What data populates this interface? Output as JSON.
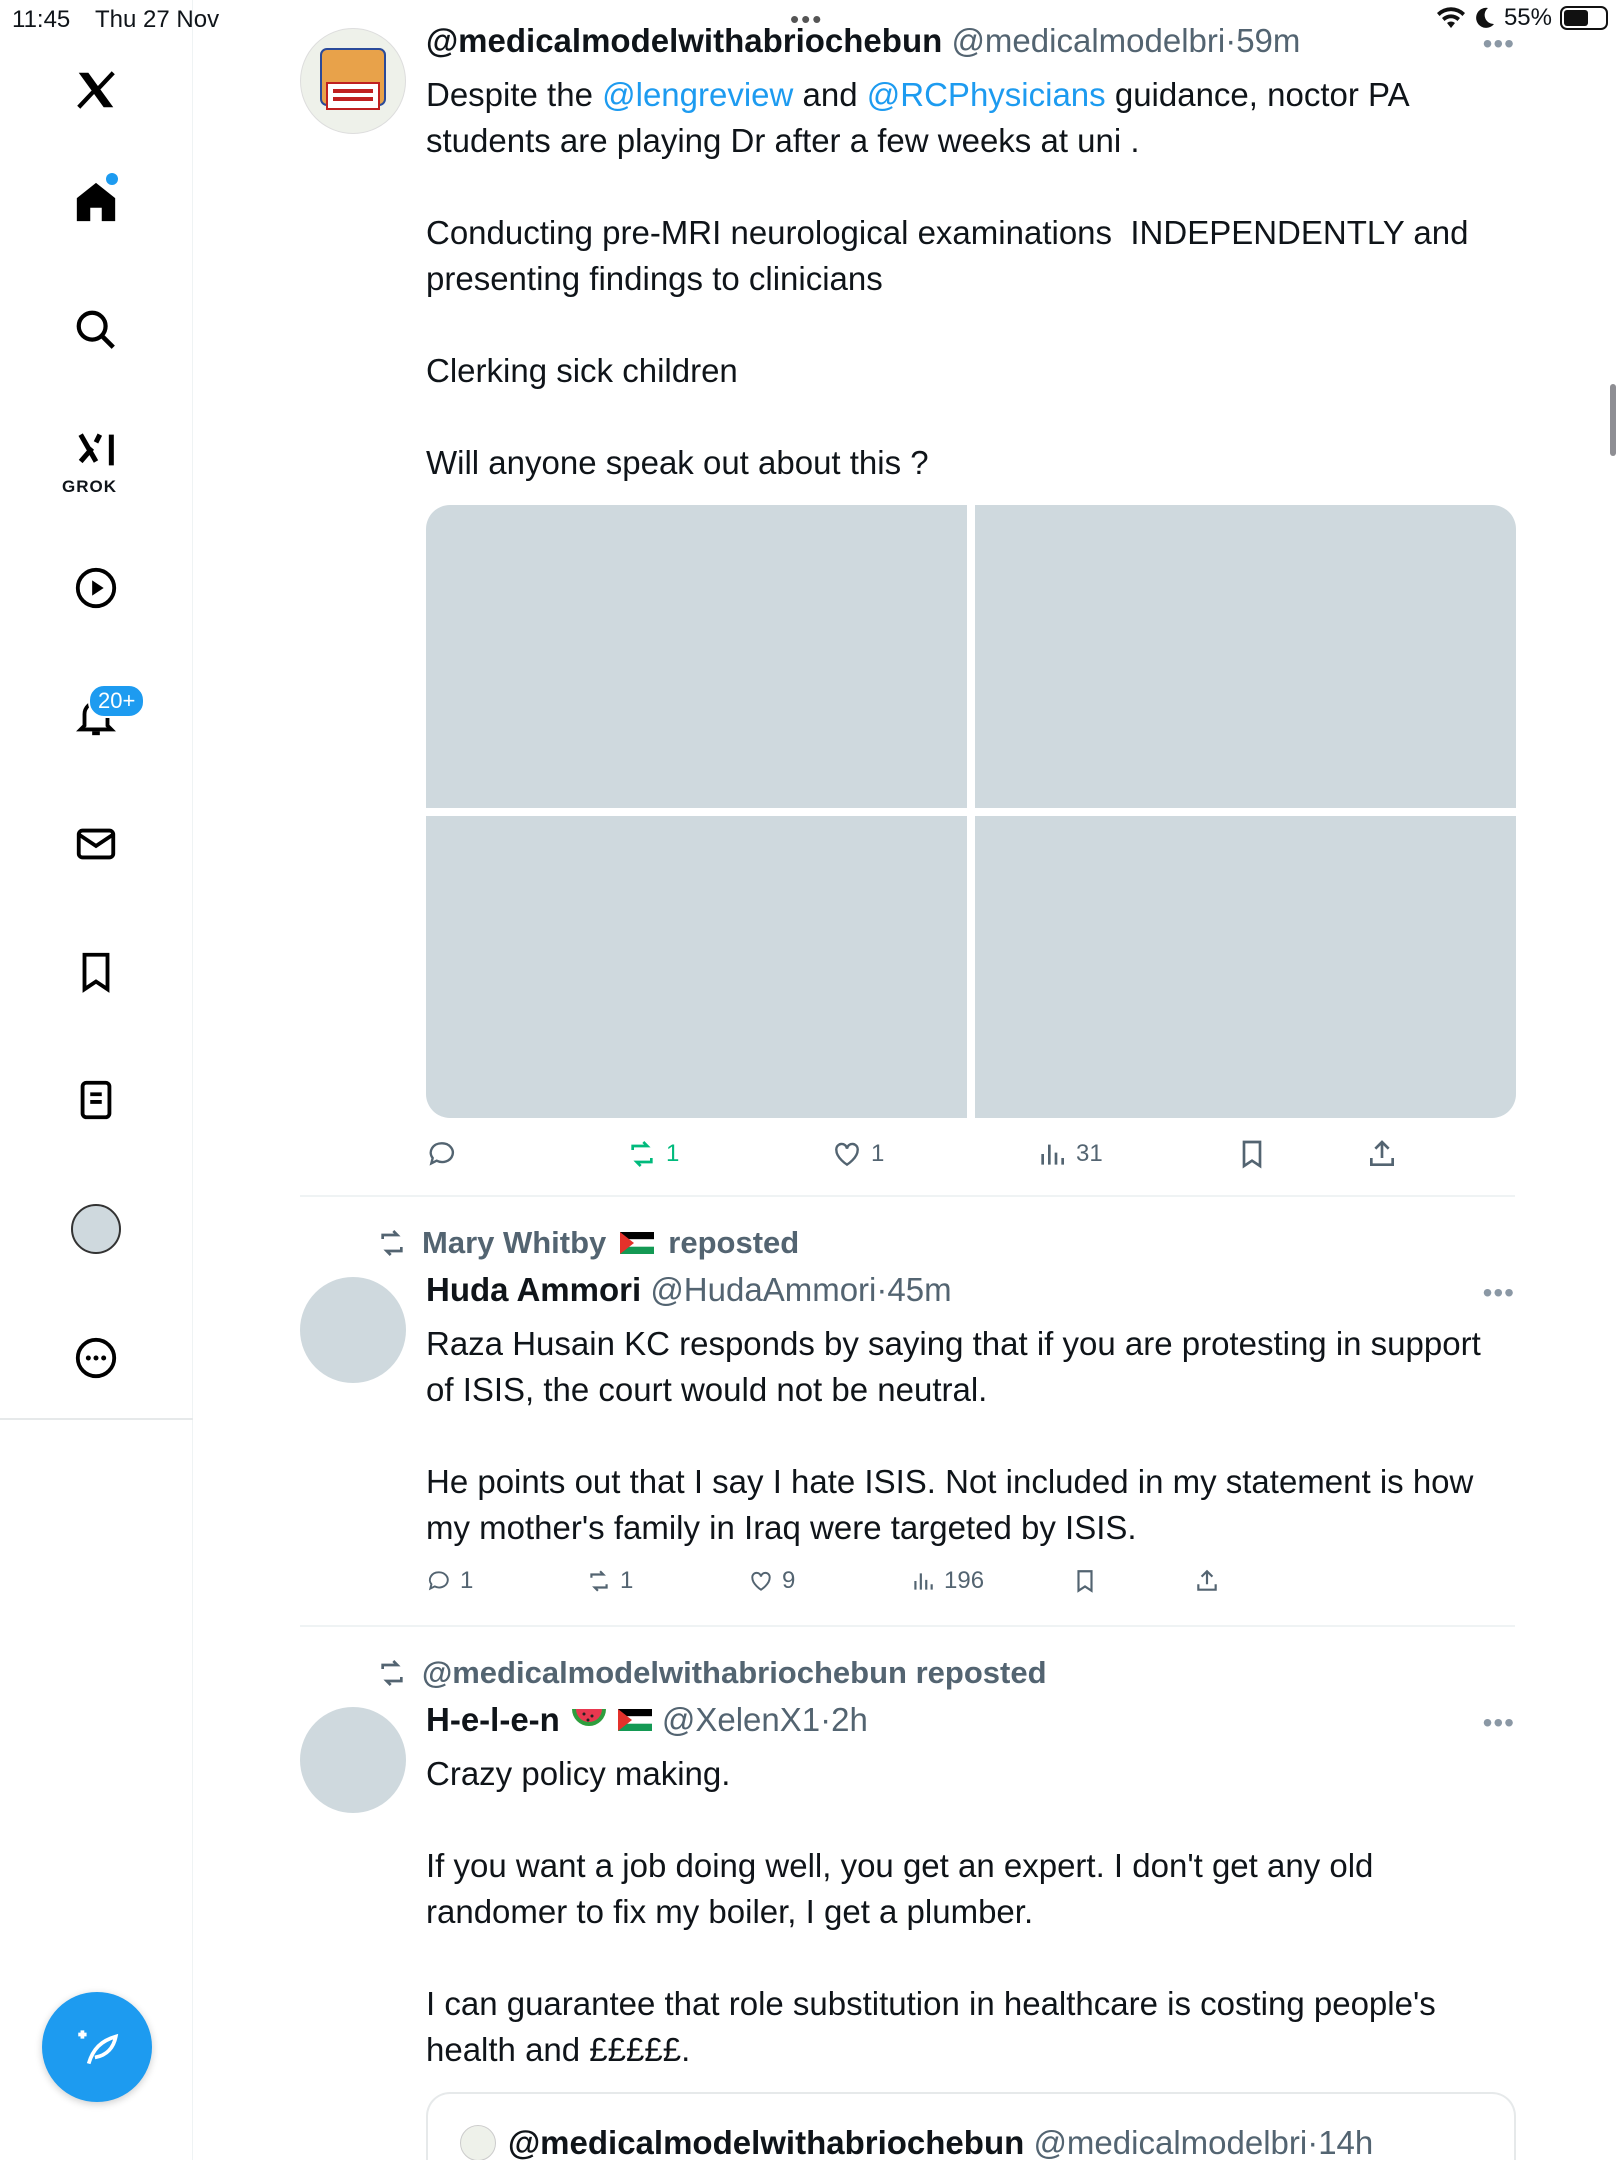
{
  "status_bar": {
    "time": "11:45",
    "date": "Thu 27 Nov",
    "battery": "55%"
  },
  "sidebar": {
    "grok_label": "GROK",
    "notification_badge": "20+"
  },
  "posts": [
    {
      "name": "@medicalmodelwithabriochebun",
      "handle": "@medicalmodelbri",
      "time": "59m",
      "text_intro": "Despite the ",
      "mention1": "@lengreview",
      "text_and": " and ",
      "mention2": "@RCPhysicians",
      "text_rest": " guidance, noctor PA students are playing Dr after a few weeks at uni .\n\nConducting pre-MRI neurological examinations  INDEPENDENTLY and presenting findings to clinicians\n\nClerking sick children\n\nWill anyone speak out about this ?",
      "replies": "",
      "reposts": "1",
      "likes": "1",
      "views": "31"
    },
    {
      "repost_by": "Mary Whitby",
      "repost_suffix": "reposted",
      "name": "Huda Ammori",
      "handle": "@HudaAmmori",
      "time": "45m",
      "text": "Raza Husain KC responds by saying that if you are protesting in support of ISIS, the court would not be neutral.\n\nHe points out that I say I hate ISIS. Not included in my statement is how my mother's family in Iraq were targeted by ISIS.",
      "replies": "1",
      "reposts": "1",
      "likes": "9",
      "views": "196"
    },
    {
      "repost_by": "@medicalmodelwithabriochebun",
      "repost_suffix": "reposted",
      "name": "H-e-l-e-n",
      "handle": "@XelenX1",
      "time": "2h",
      "text": "Crazy policy making.\n\nIf you want a job doing well, you get an expert. I don't get any old randomer to fix my boiler, I get a plumber.\n\nI can guarantee that role substitution in healthcare is costing people's health and £££££.",
      "quote": {
        "name": "@medicalmodelwithabriochebun",
        "handle": "@medicalmodelbri",
        "time": "14h"
      }
    }
  ],
  "separator": "·",
  "colors": {
    "accent": "#1d9bf0",
    "repost_green": "#00ba7c",
    "muted": "#536471"
  }
}
